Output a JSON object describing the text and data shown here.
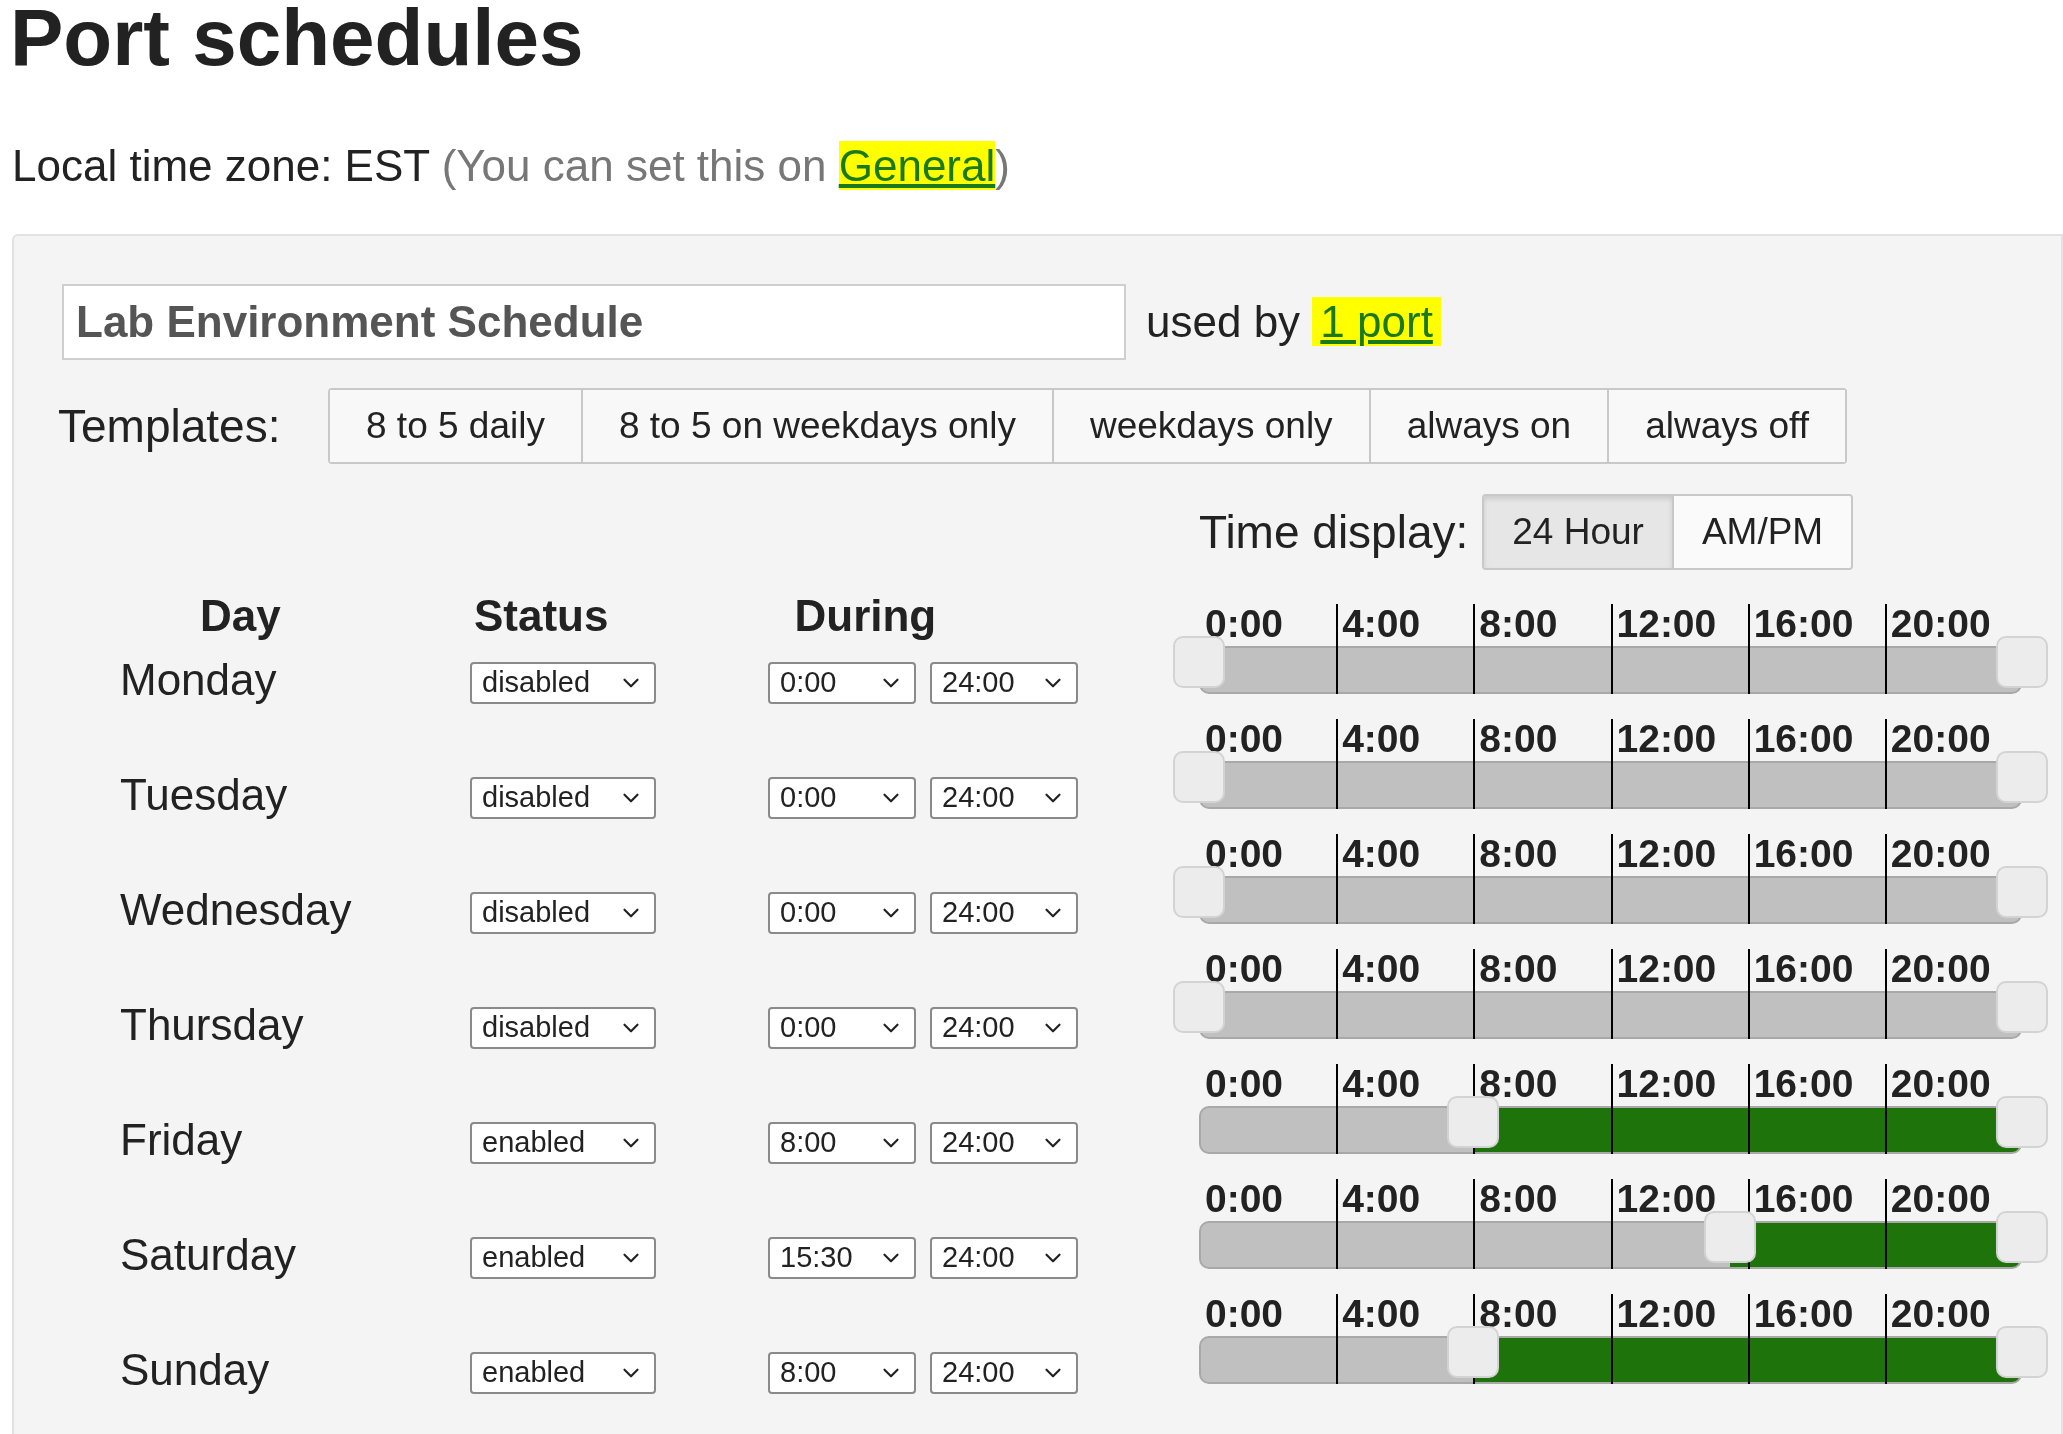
{
  "title": "Port schedules",
  "timezone": {
    "label": "Local time zone: EST",
    "hint": "(You can set this on ",
    "link": "General",
    "hint_end": ")"
  },
  "schedule": {
    "name": "Lab Environment Schedule",
    "used_by": "used by",
    "used_by_link": "1 port",
    "templates_label": "Templates:",
    "templates": [
      "8 to 5 daily",
      "8 to 5 on weekdays only",
      "weekdays only",
      "always on",
      "always off"
    ],
    "time_display": {
      "label": "Time display:",
      "options": [
        {
          "label": "24 Hour",
          "selected": true
        },
        {
          "label": "AM/PM",
          "selected": false
        }
      ]
    },
    "columns": [
      "Day",
      "Status",
      "During"
    ],
    "days": [
      {
        "name": "Monday",
        "status": "disabled",
        "enabled": false,
        "from": "0:00",
        "to": "24:00",
        "ticks": [
          "0:00",
          "4:00",
          "8:00",
          "12:00",
          "16:00",
          "20:00"
        ],
        "range": {
          "start": {
            "level": 0
          },
          "end": {
            "level": 1
          }
        }
      },
      {
        "name": "Tuesday",
        "status": "disabled",
        "enabled": false,
        "from": "0:00",
        "to": "24:00",
        "ticks": [
          "0:00",
          "4:00",
          "8:00",
          "12:00",
          "16:00",
          "20:00"
        ],
        "range": {
          "start": {
            "level": 0
          },
          "end": {
            "level": 1
          }
        }
      },
      {
        "name": "Wednesday",
        "status": "disabled",
        "enabled": false,
        "from": "0:00",
        "to": "24:00",
        "ticks": [
          "0:00",
          "4:00",
          "8:00",
          "12:00",
          "16:00",
          "20:00"
        ],
        "range": {
          "start": {
            "level": 0
          },
          "end": {
            "level": 1
          }
        }
      },
      {
        "name": "Thursday",
        "status": "disabled",
        "enabled": false,
        "from": "0:00",
        "to": "24:00",
        "ticks": [
          "0:00",
          "4:00",
          "8:00",
          "12:00",
          "16:00",
          "20:00"
        ],
        "range": {
          "start": {
            "level": 0
          },
          "end": {
            "level": 1
          }
        }
      },
      {
        "name": "Friday",
        "status": "enabled",
        "enabled": true,
        "from": "8:00",
        "to": "24:00",
        "ticks": [
          "0:00",
          "4:00",
          "8:00",
          "12:00",
          "16:00",
          "20:00"
        ],
        "range": {
          "start": {
            "level": 0.3333
          },
          "end": {
            "level": 1
          }
        }
      },
      {
        "name": "Saturday",
        "status": "enabled",
        "enabled": true,
        "from": "15:30",
        "to": "24:00",
        "ticks": [
          "0:00",
          "4:00",
          "8:00",
          "12:00",
          "16:00",
          "20:00"
        ],
        "range": {
          "start": {
            "level": 0.6458
          },
          "end": {
            "level": 1
          }
        }
      },
      {
        "name": "Sunday",
        "status": "enabled",
        "enabled": true,
        "from": "8:00",
        "to": "24:00",
        "ticks": [
          "0:00",
          "4:00",
          "8:00",
          "12:00",
          "16:00",
          "20:00"
        ],
        "range": {
          "start": {
            "level": 0.3333
          },
          "end": {
            "level": 1
          }
        }
      }
    ]
  }
}
